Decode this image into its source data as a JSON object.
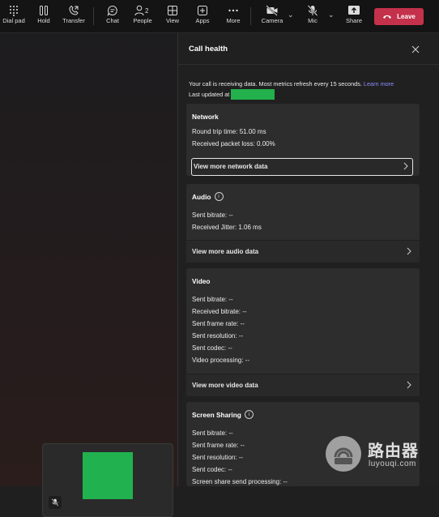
{
  "toolbar": {
    "dial_pad": "Dial pad",
    "hold": "Hold",
    "transfer": "Transfer",
    "chat": "Chat",
    "people": "People",
    "people_count": "2",
    "view": "View",
    "apps": "Apps",
    "more": "More",
    "camera": "Camera",
    "mic": "Mic",
    "share": "Share",
    "leave": "Leave"
  },
  "colors": {
    "leave": "#c4314b",
    "link": "#8e8cff",
    "redacted": "#22b14c"
  },
  "panel": {
    "title": "Call health",
    "info_text": "Your call is receiving data. Most metrics refresh every 15 seconds.",
    "learn_more": "Learn more",
    "last_updated_label": "Last updated at"
  },
  "network": {
    "title": "Network",
    "round_trip": "Round trip time: 51.00 ms",
    "packet_loss": "Received packet loss: 0.00%",
    "link": "View more network data"
  },
  "audio": {
    "title": "Audio",
    "sent_bitrate": "Sent bitrate: --",
    "jitter": "Received Jitter: 1.06 ms",
    "link": "View more audio data"
  },
  "video": {
    "title": "Video",
    "sent_bitrate": "Sent bitrate: --",
    "received_bitrate": "Received bitrate: --",
    "sent_frame_rate": "Sent frame rate: --",
    "sent_resolution": "Sent resolution: --",
    "sent_codec": "Sent codec: --",
    "processing": "Video processing: --",
    "link": "View more video data"
  },
  "screen_sharing": {
    "title": "Screen Sharing",
    "sent_bitrate": "Sent bitrate: --",
    "sent_frame_rate": "Sent frame rate: --",
    "sent_resolution": "Sent resolution: --",
    "sent_codec": "Sent codec: --",
    "send_processing": "Screen share send processing: --"
  },
  "watermark": {
    "text": "路由器",
    "sub": "luyouqi.com"
  }
}
